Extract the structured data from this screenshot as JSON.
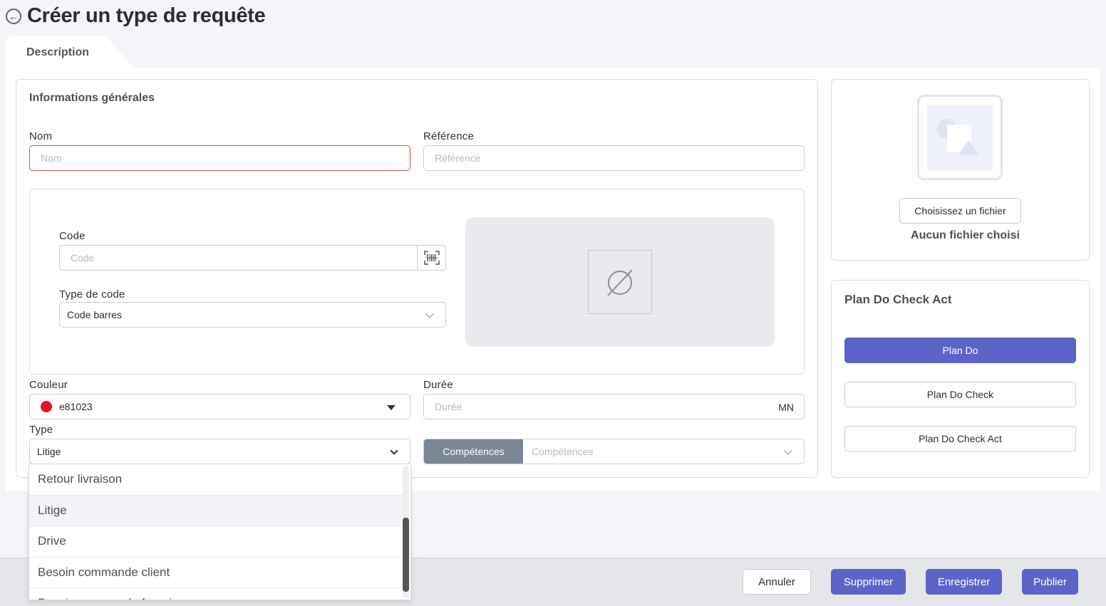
{
  "header": {
    "title": "Créer un type de requête",
    "back_icon": "arrow-left-circle-icon"
  },
  "tabs": [
    {
      "label": "Description",
      "active": true
    }
  ],
  "general": {
    "title": "Informations générales",
    "nom": {
      "label": "Nom",
      "placeholder": "Nom",
      "value": ""
    },
    "reference": {
      "label": "Référence",
      "placeholder": "Référence",
      "value": ""
    },
    "code": {
      "label": "Code",
      "placeholder": "Code",
      "value": ""
    },
    "type_de_code": {
      "label": "Type de code",
      "value": "Code barres"
    },
    "couleur": {
      "label": "Couleur",
      "value": "e81023",
      "swatch": "#e81023"
    },
    "duree": {
      "label": "Durée",
      "placeholder": "Durée",
      "unit": "MN"
    },
    "type": {
      "label": "Type",
      "value": "Litige"
    },
    "competences": {
      "tag": "Compétences",
      "placeholder": "Compétences"
    }
  },
  "type_dropdown": {
    "options": [
      "Retour livraison",
      "Litige",
      "Drive",
      "Besoin commande client",
      "Besoin commande fournisseur"
    ],
    "selected": "Litige"
  },
  "image_upload": {
    "button": "Choisissez un fichier",
    "status": "Aucun fichier choisi"
  },
  "pdca": {
    "title": "Plan Do Check Act",
    "options": [
      "Plan Do",
      "Plan Do Check",
      "Plan Do Check Act"
    ],
    "selected": "Plan Do"
  },
  "footer": {
    "cancel": "Annuler",
    "delete": "Supprimer",
    "save": "Enregistrer",
    "publish": "Publier"
  },
  "colors": {
    "primary": "#5d64c8",
    "error_border": "#d44c4c",
    "tag_bg": "#7b8794"
  }
}
